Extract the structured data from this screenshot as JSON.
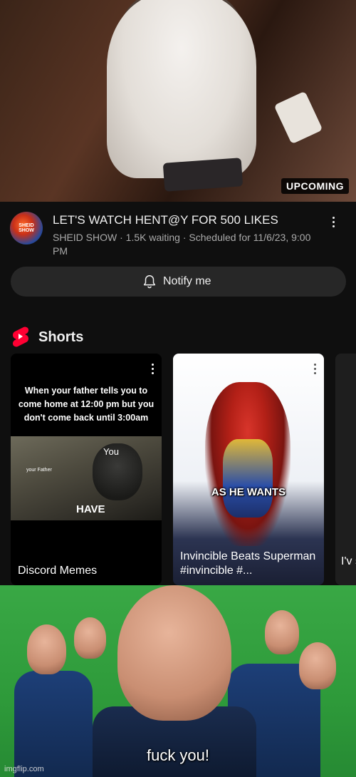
{
  "thumbnail": {
    "badge": "UPCOMING"
  },
  "video": {
    "channel_avatar_text": "SHEID SHOW",
    "title": "LET'S WATCH HENT@Y FOR 500 LIKES",
    "meta": "SHEID SHOW · 1.5K waiting · Scheduled for 11/6/23, 9:00 PM",
    "menu_icon": "more-vert-icon"
  },
  "notify": {
    "label": "Notify me",
    "icon": "bell-icon"
  },
  "shorts": {
    "heading": "Shorts",
    "icon": "youtube-shorts-icon",
    "items": [
      {
        "meme_text": "When your father tells you to come home at 12:00 pm but you don't come back until 3:00am",
        "overlay_you": "You",
        "overlay_father": "your Father",
        "overlay_have": "HAVE",
        "label": "Discord Memes"
      },
      {
        "overlay": "AS HE WANTS",
        "label": "Invincible Beats Superman #invincible #..."
      },
      {
        "label": "I'v str"
      }
    ]
  },
  "meme": {
    "subtitle": "fuck you!",
    "watermark": "imgflip.com"
  },
  "colors": {
    "background": "#0f0f0f",
    "button": "#272727",
    "shorts_red": "#ff0033",
    "green_screen": "#2e9a3a"
  }
}
